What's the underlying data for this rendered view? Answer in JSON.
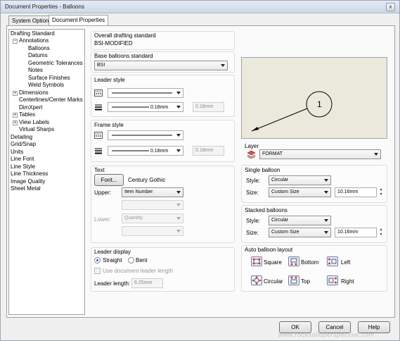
{
  "window": {
    "title": "Document Properties - Balloons",
    "close": "x"
  },
  "tabs": [
    {
      "label": "System Options"
    },
    {
      "label": "Document Properties"
    }
  ],
  "tree": {
    "root": "Drafting Standard",
    "annotations": "Annotations",
    "annotation_children": [
      "Balloons",
      "Datums",
      "Geometric Tolerances",
      "Notes",
      "Surface Finishes",
      "Weld Symbols"
    ],
    "dimensions": "Dimensions",
    "centerlines": "Centerlines/Center Marks",
    "dimxpert": "DimXpert",
    "tables": "Tables",
    "view_labels": "View Labels",
    "virtual_sharps": "Virtual Sharps",
    "rest": [
      "Detailing",
      "Grid/Snap",
      "Units",
      "Line Font",
      "Line Style",
      "Line Thickness",
      "Image Quality",
      "Sheet Metal"
    ]
  },
  "overall": {
    "label": "Overall drafting standard",
    "value": "BSI-MODIFIED"
  },
  "base_balloons": {
    "label": "Base balloons standard",
    "value": "BSI"
  },
  "leader_style": {
    "label": "Leader style",
    "thickness": "0.18mm",
    "custom": "0.18mm"
  },
  "frame_style": {
    "label": "Frame style",
    "thickness": "0.18mm",
    "custom": "0.18mm"
  },
  "text": {
    "label": "Text",
    "font_button": "Font...",
    "font_name": "Century Gothic",
    "upper_label": "Upper:",
    "upper_value": "Item Number",
    "lower_label": "Lower:",
    "lower_value": "Quantity"
  },
  "leader_display": {
    "label": "Leader display",
    "straight": "Straight",
    "bent": "Bent",
    "use_doc": "Use document leader length",
    "length_label": "Leader length:",
    "length_value": "6.25mm"
  },
  "preview": {
    "balloon_text": "1"
  },
  "layer": {
    "label": "Layer",
    "value": "FORMAT"
  },
  "single_balloon": {
    "label": "Single balloon",
    "style_label": "Style:",
    "style_value": "Circular",
    "size_label": "Size:",
    "size_value": "Custom Size",
    "size_num": "10.16mm"
  },
  "stacked_balloons": {
    "label": "Stacked balloons",
    "style_label": "Style:",
    "style_value": "Circular",
    "size_label": "Size:",
    "size_value": "Custom Size",
    "size_num": "10.16mm"
  },
  "auto_layout": {
    "label": "Auto balloon layout",
    "square": "Square",
    "bottom": "Bottom",
    "left": "Left",
    "circular": "Circular",
    "top": "Top",
    "right": "Right"
  },
  "buttons": {
    "ok": "OK",
    "cancel": "Cancel",
    "help": "Help"
  },
  "watermark": "www.rocksolidperspective.com"
}
